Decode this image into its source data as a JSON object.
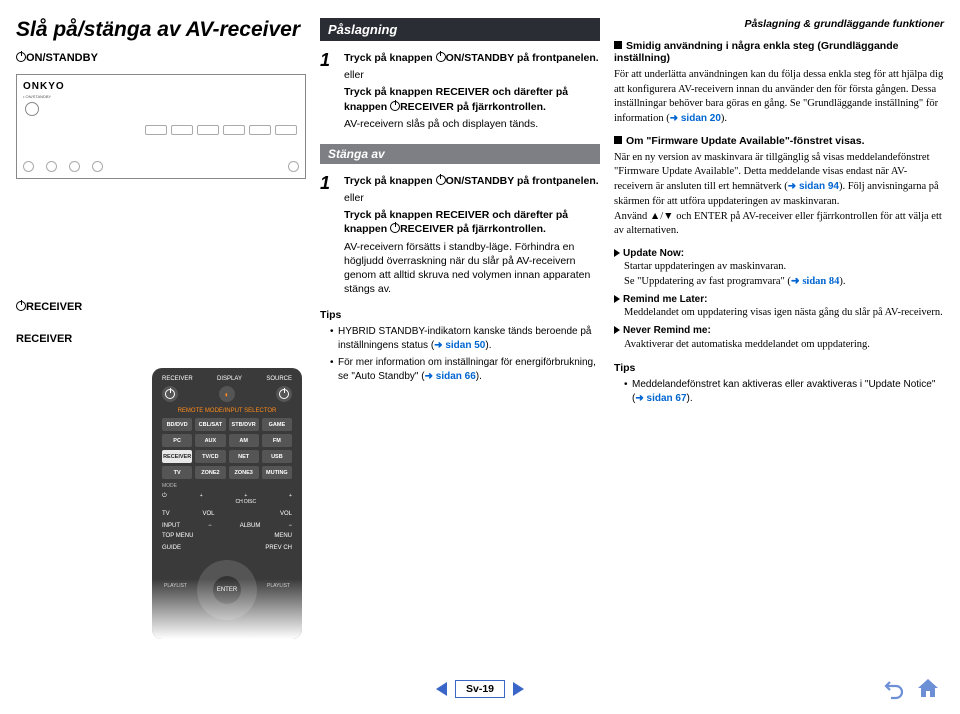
{
  "headerRight": "Påslagning & grundläggande funktioner",
  "left": {
    "title": "Slå på/stänga av AV-receiver",
    "onStandby": "ON/STANDBY",
    "receiverP": "RECEIVER",
    "receiver": "RECEIVER",
    "brand": "ONKYO"
  },
  "mid": {
    "sectionOn": "Påslagning",
    "step1": {
      "a": "Tryck på knappen ",
      "b": "ON/STANDBY på frontpanelen.",
      "or": "eller",
      "c": "Tryck på knappen RECEIVER och därefter på knappen ",
      "d": "RECEIVER på fjärrkontrollen.",
      "e": "AV-receivern slås på och displayen tänds."
    },
    "sectionOff": "Stänga av",
    "step2": {
      "a": "Tryck på knappen ",
      "b": "ON/STANDBY på frontpanelen.",
      "or": "eller",
      "c": "Tryck på knappen RECEIVER och därefter på knappen ",
      "d": "RECEIVER på fjärrkontrollen.",
      "e": "AV-receivern försätts i standby-läge. Förhindra en högljudd överraskning när du slår på AV-receivern genom att alltid skruva ned volymen innan apparaten stängs av."
    },
    "tips": "Tips",
    "tipsItems": [
      {
        "pre": "HYBRID STANDBY",
        "post": "-indikatorn kanske tänds beroende på inställningens status (",
        "link": "sidan 50",
        "end": ")."
      },
      {
        "pre": "",
        "post": "För mer information om inställningar för energiförbrukning, se \"Auto Standby\" (",
        "link": "sidan 66",
        "end": ")."
      }
    ]
  },
  "right": {
    "sq1": "Smidig användning i några enkla steg (Grundläggande inställning)",
    "p1": "För att underlätta användningen kan du följa dessa enkla steg för att hjälpa dig att konfigurera AV-receivern innan du använder den för första gången. Dessa inställningar behöver bara göras en gång. Se \"Grundläggande inställning\" för information (",
    "p1link": "sidan 20",
    "p1end": ").",
    "sq2": "Om \"Firmware Update Available\"-fönstret visas.",
    "p2a": "När en ny version av maskinvara är tillgänglig så visas meddelandefönstret \"Firmware Update Available\". Detta meddelande visas endast när AV-receivern är ansluten till ert hemnätverk (",
    "p2alink": "sidan 94",
    "p2amid": "). Följ anvisningarna på skärmen för att utföra uppdateringen av maskinvaran.",
    "p2b": "Använd ▲/▼ och ENTER på AV-receiver eller fjärrkontrollen för att välja ett av alternativen.",
    "opt1h": "Update Now:",
    "opt1a": "Startar uppdateringen av maskinvaran.",
    "opt1b": "Se \"Uppdatering av fast programvara\" (",
    "opt1blink": "sidan 84",
    "opt1bend": ").",
    "opt2h": "Remind me Later:",
    "opt2a": "Meddelandet om uppdatering visas igen nästa gång du slår på AV-receivern.",
    "opt3h": "Never Remind me:",
    "opt3a": "Avaktiverar det automatiska meddelandet om uppdatering.",
    "tips": "Tips",
    "tipItem": "Meddelandefönstret kan aktiveras eller avaktiveras i \"Update Notice\" (",
    "tipLink": "sidan 67",
    "tipEnd": ")."
  },
  "remote": {
    "labels": [
      "RECEIVER",
      "DISPLAY",
      "SOURCE"
    ],
    "mode": "REMOTE MODE/INPUT SELECTOR",
    "buttons": [
      "BD/DVD",
      "CBL/SAT",
      "STB/DVR",
      "GAME",
      "PC",
      "AUX",
      "AM",
      "FM",
      "RECEIVER",
      "TV/CD",
      "NET",
      "USB",
      "TV",
      "ZONE2",
      "ZONE3",
      "MUTING"
    ],
    "modeL": "MODE",
    "nav": {
      "tv": "TV",
      "vol": "VOL",
      "chdisc": "CH DISC",
      "album": "ALBUM",
      "input": "INPUT",
      "top": "TOP MENU",
      "menu": "MENU",
      "guide": "GUIDE",
      "prev": "PREV CH",
      "playlistL": "PLAYLIST",
      "playlistR": "PLAYLIST",
      "enter": "ENTER"
    }
  },
  "footer": {
    "page": "Sv-19"
  }
}
